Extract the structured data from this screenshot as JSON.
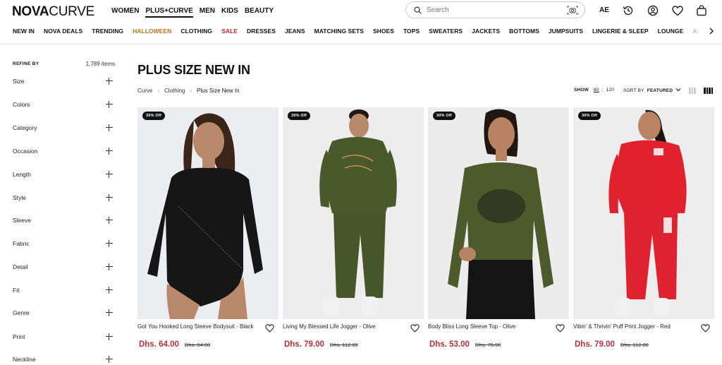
{
  "brand": {
    "logo_bold": "NOVA",
    "logo_light": "CURVE"
  },
  "primary_nav": [
    "WOMEN",
    "PLUS+CURVE",
    "MEN",
    "KIDS",
    "BEAUTY"
  ],
  "search": {
    "placeholder": "Search"
  },
  "region": "AE",
  "icons": [
    "search-icon",
    "camera-icon",
    "history-icon",
    "account-icon",
    "heart-icon",
    "bag-icon",
    "chevron-right-icon",
    "plus-icon"
  ],
  "category_nav": [
    "NEW IN",
    "NOVA DEALS",
    "TRENDING",
    "HALLOWEEN",
    "CLOTHING",
    "SALE",
    "DRESSES",
    "JEANS",
    "MATCHING SETS",
    "SHOES",
    "TOPS",
    "SWEATERS",
    "JACKETS",
    "BOTTOMS",
    "JUMPSUITS",
    "LINGERIE & SLEEP",
    "LOUNGE",
    "A"
  ],
  "colors": {
    "halloween": "#b8741a",
    "sale": "#c4262e",
    "price": "#b5313a"
  },
  "sidebar": {
    "refine_label": "REFINE BY",
    "item_count": "1,789 items",
    "filters": [
      "Size",
      "Colors",
      "Category",
      "Occasion",
      "Length",
      "Style",
      "Sleeve",
      "Fabric",
      "Detail",
      "Fit",
      "Genre",
      "Print",
      "Neckline"
    ]
  },
  "page": {
    "title": "PLUS SIZE NEW IN"
  },
  "breadcrumb": [
    "Curve",
    "Clothing",
    "Plus Size New In"
  ],
  "toolbar": {
    "show_label": "SHOW",
    "show_options": [
      "60",
      "120"
    ],
    "show_selected": "60",
    "sort_label": "SORT BY",
    "sort_value": "FEATURED"
  },
  "products": [
    {
      "badge": "30% Off",
      "name": "Got You Hooked Long Sleeve Bodysuit - Black",
      "price": "Dhs. 64.00",
      "original_price": "Dhs. 94.00"
    },
    {
      "badge": "30% Off",
      "name": "Living My Blessed Life Jogger - Olive",
      "price": "Dhs. 79.00",
      "original_price": "Dhs. 112.00"
    },
    {
      "badge": "30% Off",
      "name": "Body Bliss Long Sleeve Top - Olive",
      "price": "Dhs. 53.00",
      "original_price": "Dhs. 75.00"
    },
    {
      "badge": "30% Off",
      "name": "Vibin' & Thrivin' Puff Print Jogger - Red",
      "price": "Dhs. 79.00",
      "original_price": "Dhs. 112.00"
    }
  ]
}
